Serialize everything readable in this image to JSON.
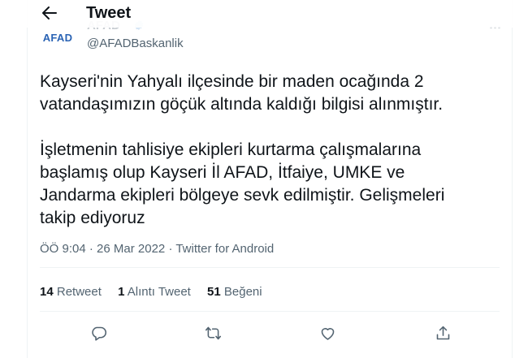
{
  "header": {
    "title": "Tweet"
  },
  "author": {
    "avatar_text": "AFAD",
    "name": "AFAD",
    "handle": "@AFADBaskanlik"
  },
  "tweet": {
    "text": "Kayseri'nin Yahyalı ilçesinde bir maden ocağında 2\nvatandaşımızın göçük altında kaldığı bilgisi alınmıştır.\n\nİşletmenin tahlisiye ekipleri kurtarma çalışmalarına\nbaşlamış olup Kayseri İl AFAD, İtfaiye, UMKE ve\nJandarma ekipleri bölgeye sevk edilmiştir. Gelişmeleri\ntakip ediyoruz",
    "time": "ÖÖ 9:04",
    "date": "26 Mar 2022",
    "source": "Twitter for Android"
  },
  "stats": {
    "retweets_count": "14",
    "retweets_label": "Retweet",
    "quotes_count": "1",
    "quotes_label": "Alıntı Tweet",
    "likes_count": "51",
    "likes_label": "Beğeni"
  },
  "colors": {
    "text": "#0f1419",
    "secondary": "#536471",
    "divider": "#eff3f4",
    "afad_blue": "#2a63b4"
  },
  "icons": [
    "back-arrow-icon",
    "verified-badge-icon",
    "more-icon",
    "reply-icon",
    "retweet-icon",
    "like-icon",
    "share-icon"
  ]
}
